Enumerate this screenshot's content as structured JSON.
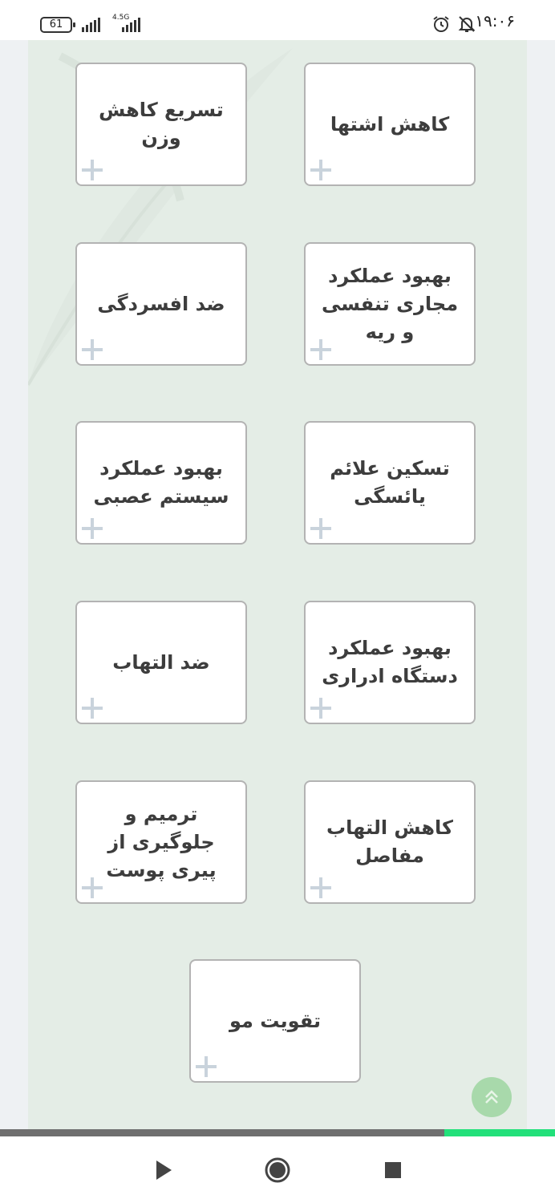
{
  "status_bar": {
    "time": "۱۹:۰۶",
    "battery": "61",
    "network": "4.5G",
    "icons": [
      "alarm-icon",
      "notifications-off-icon",
      "signal-icon",
      "signal-icon"
    ]
  },
  "cards": [
    {
      "label": "کاهش اشتها"
    },
    {
      "label": "تسریع کاهش وزن"
    },
    {
      "label": "بهبود عملکرد مجاری تنفسی و ریه"
    },
    {
      "label": "ضد افسردگی"
    },
    {
      "label": "تسکین علائم یائسگی"
    },
    {
      "label": "بهبود عملکرد سیستم عصبی"
    },
    {
      "label": "بهبود عملکرد دستگاه ادراری"
    },
    {
      "label": "ضد التهاب"
    },
    {
      "label": "کاهش التهاب مفاصل"
    },
    {
      "label": "ترمیم و جلوگیری از پیری پوست"
    },
    {
      "label": "تقویت مو"
    }
  ],
  "card_icon": "plus-icon",
  "scroll_top_icon": "double-chevron-up-icon",
  "progress": 0.2,
  "nav": [
    "back-icon",
    "home-icon",
    "recents-icon"
  ],
  "colors": {
    "panel": "#e4ede6",
    "card_border": "#b3b3b3",
    "accent": "#22e07a",
    "fab": "#a8d9ab"
  }
}
